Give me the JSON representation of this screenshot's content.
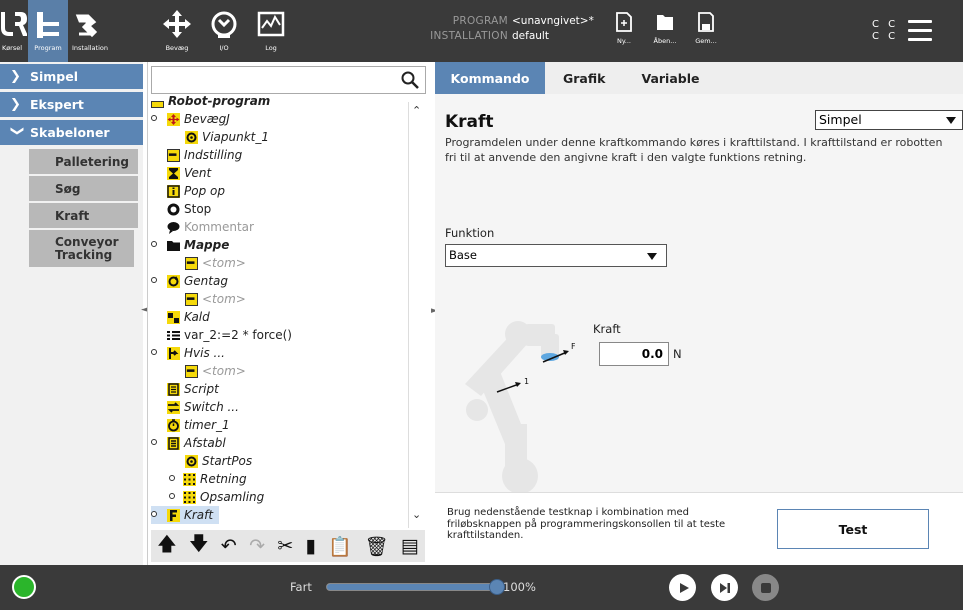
{
  "nav": {
    "run": "Kørsel",
    "program": "Program",
    "installation": "Installation",
    "move": "Bevæg",
    "io": "I/O",
    "log": "Log"
  },
  "program_info": {
    "program_label": "PROGRAM",
    "program_value": "<unavngivet>*",
    "installation_label": "INSTALLATION",
    "installation_value": "default"
  },
  "file": {
    "new": "Ny...",
    "open": "Åben...",
    "save": "Gem..."
  },
  "cc_top": "C C",
  "cc_bottom": "C C",
  "sidebar": {
    "categories": [
      "Simpel",
      "Ekspert",
      "Skabeloner"
    ],
    "templates": [
      "Palletering",
      "Søg",
      "Kraft",
      "Conveyor Tracking"
    ]
  },
  "tree": {
    "search_placeholder": "",
    "nodes": [
      "Robot-program",
      "BevægJ",
      "Viapunkt_1",
      "Indstilling",
      "Vent",
      "Pop op",
      "Stop",
      "Kommentar",
      "Mappe",
      "<tom>",
      "Gentag",
      "<tom>",
      "Kald",
      "var_2:=2 * force()",
      "Hvis ...",
      "<tom>",
      "Script",
      "Switch ...",
      "timer_1",
      "Afstabl",
      "StartPos",
      "Retning",
      "Opsamling",
      "Kraft"
    ]
  },
  "tabs": [
    "Kommando",
    "Grafik",
    "Variable"
  ],
  "command": {
    "title": "Kraft",
    "mode": "Simpel",
    "description": "Programdelen under denne kraftkommando køres i krafttilstand. I krafttilstand er robotten fri til at anvende den angivne kraft i den valgte funktions retning.",
    "function_label": "Funktion",
    "function_value": "Base",
    "force_label": "Kraft",
    "force_value": "0.0",
    "force_unit": "N",
    "robot_label_f": "F",
    "robot_label_1": "1"
  },
  "footer": {
    "hint": "Brug nedenstående testknap i kombination med friløbsknappen på programmeringskonsollen til at teste krafttilstanden.",
    "test_button": "Test"
  },
  "bottom": {
    "speed_label": "Fart",
    "speed_value": "100%",
    "speed_fraction": 1.0
  },
  "colors": {
    "accent": "#5b85b4",
    "header": "#3a3a3a",
    "power_ok": "#2bb52b",
    "node_yellow": "#f5d90a"
  }
}
